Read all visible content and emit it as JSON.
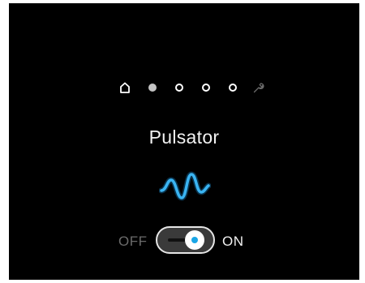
{
  "mode": {
    "title": "Pulsator",
    "icon": "pulsator-wave-icon"
  },
  "nav": {
    "items": [
      {
        "icon": "home-icon",
        "state": "inactive"
      },
      {
        "icon": "page-dot",
        "state": "active"
      },
      {
        "icon": "page-dot",
        "state": "inactive"
      },
      {
        "icon": "page-dot",
        "state": "inactive"
      },
      {
        "icon": "page-dot",
        "state": "inactive"
      },
      {
        "icon": "wrench-icon",
        "state": "inactive"
      }
    ]
  },
  "toggle": {
    "off_label": "OFF",
    "on_label": "ON",
    "state": "on"
  },
  "colors": {
    "background": "#000000",
    "accent": "#1aa6e6",
    "wave": "#3ab4f2",
    "inactive_text": "#6b6b6b",
    "active_dot": "#c4c4c4"
  }
}
